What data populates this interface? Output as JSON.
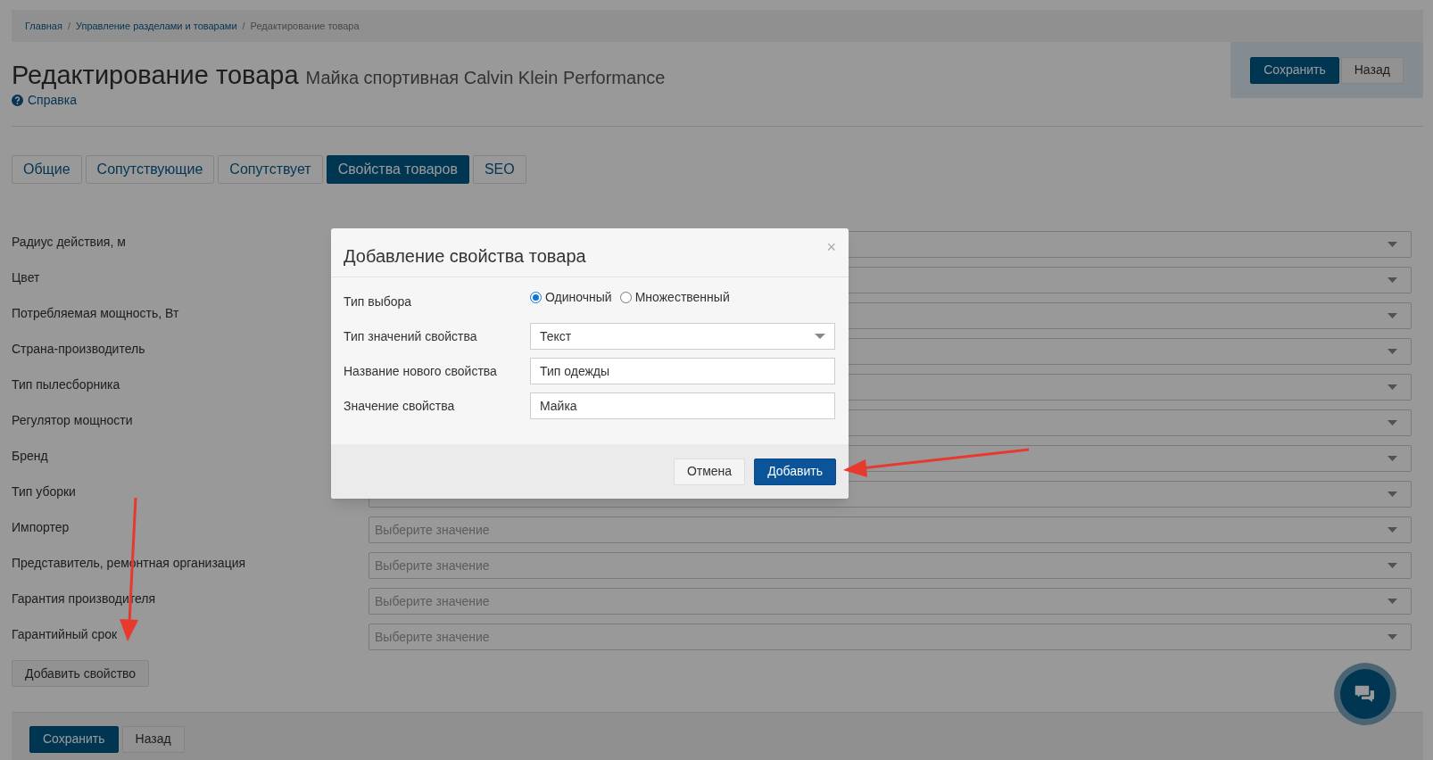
{
  "breadcrumb_separator": "/",
  "breadcrumbs": [
    {
      "label": "Главная",
      "link": true
    },
    {
      "label": "Управление разделами и товарами",
      "link": true
    },
    {
      "label": "Редактирование товара",
      "link": false
    }
  ],
  "page": {
    "title": "Редактирование товара",
    "subtitle": "Майка спортивная Calvin Klein Performance",
    "help_link": "Справка"
  },
  "header_buttons": [
    {
      "label": "Сохранить",
      "kind": "primary"
    },
    {
      "label": "Назад",
      "kind": "default"
    }
  ],
  "tabs": [
    {
      "label": "Общие",
      "selected": false
    },
    {
      "label": "Сопутствующие",
      "selected": false
    },
    {
      "label": "Сопутствует",
      "selected": false
    },
    {
      "label": "Свойства товаров",
      "selected": true
    },
    {
      "label": "SEO",
      "selected": false
    }
  ],
  "properties": [
    {
      "label": "Радиус действия, м"
    },
    {
      "label": "Цвет"
    },
    {
      "label": "Потребляемая мощность, Вт"
    },
    {
      "label": "Страна-производитель"
    },
    {
      "label": "Тип пылесборника"
    },
    {
      "label": "Регулятор мощности"
    },
    {
      "label": "Бренд"
    },
    {
      "label": "Тип уборки"
    },
    {
      "label": "Импортер",
      "placeholder": "Выберите значение"
    },
    {
      "label": "Представитель, ремонтная организация",
      "placeholder": "Выберите значение"
    },
    {
      "label": "Гарантия производителя",
      "placeholder": "Выберите значение"
    },
    {
      "label": "Гарантийный срок",
      "placeholder": "Выберите значение"
    }
  ],
  "add_property_button": "Добавить свойство",
  "footer_buttons": [
    {
      "label": "Сохранить",
      "kind": "primary"
    },
    {
      "label": "Назад",
      "kind": "default"
    }
  ],
  "modal": {
    "title": "Добавление свойства товара",
    "close": "×",
    "fields": [
      {
        "kind": "radio",
        "label": "Тип выбора",
        "options": [
          {
            "label": "Одиночный",
            "selected": true
          },
          {
            "label": "Множественный",
            "selected": false
          }
        ]
      },
      {
        "kind": "select",
        "label": "Тип значений свойства",
        "value": "Текст"
      },
      {
        "kind": "input",
        "label": "Название нового свойства",
        "value": "Тип одежды"
      },
      {
        "kind": "input",
        "label": "Значение свойства",
        "value": "Майка"
      }
    ],
    "buttons": [
      {
        "label": "Отмена",
        "kind": "default"
      },
      {
        "label": "Добавить",
        "kind": "primary"
      }
    ]
  }
}
